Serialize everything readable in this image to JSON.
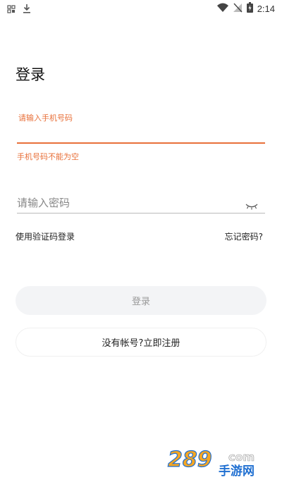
{
  "status_bar": {
    "time": "2:14",
    "left_icons": [
      "gallery-icon",
      "download-icon"
    ],
    "right_icons": [
      "wifi-icon",
      "no-signal-icon",
      "battery-charging-icon"
    ]
  },
  "page": {
    "title": "登录"
  },
  "phone_field": {
    "label": "请输入手机号码",
    "value": "",
    "error": "手机号码不能为空"
  },
  "password_field": {
    "placeholder": "请输入密码",
    "value": "",
    "toggle_icon": "eye-closed-icon"
  },
  "links": {
    "sms_login": "使用验证码登录",
    "forgot_password": "忘记密码?"
  },
  "buttons": {
    "login": "登录",
    "register": "没有帐号?立即注册"
  },
  "watermark": {
    "main": "289",
    "suffix": "com",
    "sub": "手游网"
  },
  "colors": {
    "accent": "#e8703a",
    "button_bg": "#f3f4f6",
    "button_text_disabled": "#999999"
  }
}
